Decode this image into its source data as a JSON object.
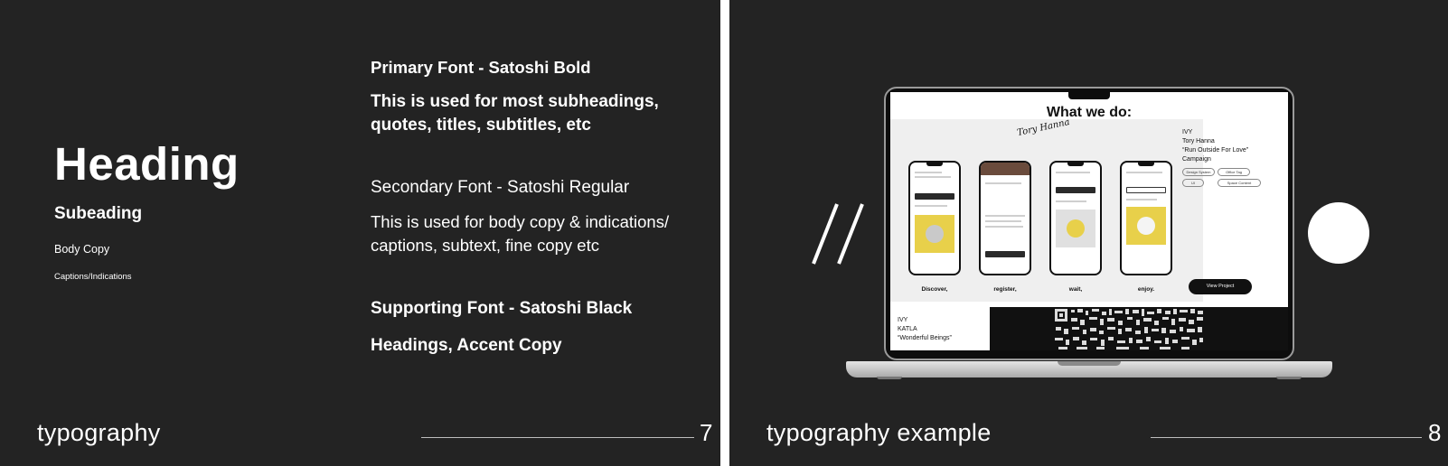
{
  "slide7": {
    "heading": "Heading",
    "subheading": "Subeading",
    "body_copy": "Body Copy",
    "captions": "Captions/Indications",
    "primary_font_title": "Primary Font - Satoshi Bold",
    "primary_font_desc_1": "This is used for most subheadings,",
    "primary_font_desc_2": "quotes, titles, subtitles, etc",
    "secondary_font_title": "Secondary Font - Satoshi Regular",
    "secondary_font_desc_1": "This is used for body copy & indications/",
    "secondary_font_desc_2": "captions, subtext, fine copy etc",
    "supporting_font_title": "Supporting Font - Satoshi Black",
    "supporting_font_desc": "Headings, Accent Copy",
    "footer_title": "typography",
    "page_number": "7"
  },
  "slide8": {
    "footer_title": "typography example",
    "page_number": "8",
    "screen": {
      "title": "What we do:",
      "signature": "Tory Hanna",
      "steps": [
        "Discover,",
        "register,",
        "wait,",
        "enjoy."
      ],
      "info_lines": [
        "IVY",
        "Tory Hanna",
        "“Run Outside For Love”",
        "Campaign"
      ],
      "tags": [
        "Design System",
        "Office Tag",
        "UI",
        "Space Content"
      ],
      "view_button": "View Project",
      "bottom_lines": [
        "IVY",
        "KATLA",
        "“Wonderful Beings”"
      ]
    }
  },
  "colors": {
    "slide_bg": "#232323",
    "text": "#ffffff",
    "accent_yellow": "#e8d04a"
  }
}
